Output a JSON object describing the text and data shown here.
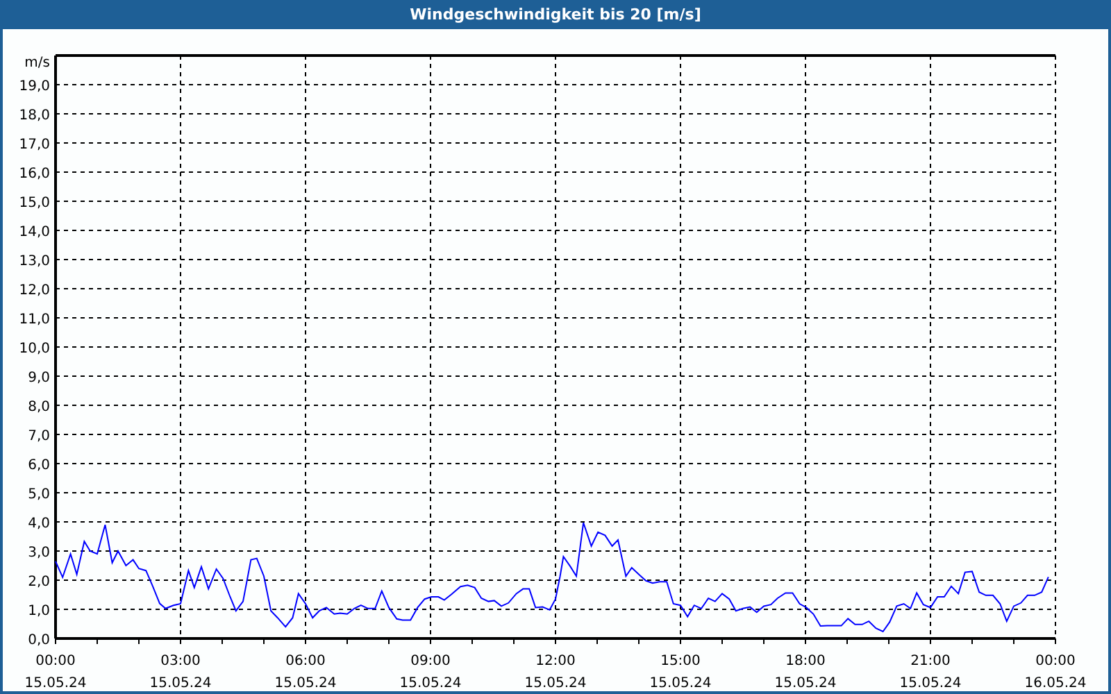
{
  "window": {
    "title": "Windgeschwindigkeit bis 20 [m/s]"
  },
  "chart": {
    "chart_data": {
      "type": "line",
      "grid": true,
      "ylabel": "m/s",
      "xlim": [
        0,
        24
      ],
      "ylim": [
        0,
        20
      ],
      "x": [
        0,
        0.17,
        0.36,
        0.51,
        0.69,
        0.83,
        1.0,
        1.19,
        1.36,
        1.5,
        1.69,
        1.86,
        2.0,
        2.17,
        2.33,
        2.5,
        2.64,
        2.83,
        3.0,
        3.19,
        3.33,
        3.5,
        3.67,
        3.86,
        4.02,
        4.19,
        4.33,
        4.5,
        4.69,
        4.83,
        5.0,
        5.17,
        5.33,
        5.52,
        5.69,
        5.83,
        6.0,
        6.17,
        6.33,
        6.5,
        6.69,
        6.83,
        7.0,
        7.17,
        7.33,
        7.5,
        7.67,
        7.83,
        8.0,
        8.19,
        8.33,
        8.52,
        8.69,
        8.86,
        9.02,
        9.19,
        9.33,
        9.5,
        9.72,
        9.89,
        10.06,
        10.22,
        10.39,
        10.53,
        10.7,
        10.87,
        11.06,
        11.22,
        11.37,
        11.52,
        11.69,
        11.86,
        12.0,
        12.11,
        12.19,
        12.36,
        12.5,
        12.67,
        12.86,
        13.02,
        13.19,
        13.36,
        13.5,
        13.69,
        13.83,
        14.02,
        14.17,
        14.33,
        14.5,
        14.67,
        14.83,
        15.0,
        15.17,
        15.33,
        15.5,
        15.67,
        15.83,
        16.0,
        16.17,
        16.33,
        16.5,
        16.67,
        16.83,
        17.0,
        17.17,
        17.33,
        17.52,
        17.69,
        17.86,
        18.02,
        18.19,
        18.36,
        18.52,
        18.69,
        18.86,
        19.02,
        19.19,
        19.36,
        19.52,
        19.69,
        19.86,
        20.02,
        20.19,
        20.36,
        20.52,
        20.67,
        20.83,
        21.0,
        21.17,
        21.33,
        21.5,
        21.67,
        21.83,
        22.0,
        22.17,
        22.33,
        22.5,
        22.67,
        22.83,
        23.0,
        23.17,
        23.33,
        23.5,
        23.67,
        23.83
      ],
      "series": [
        {
          "color": "#0000ff",
          "values": [
            2.65,
            2.1,
            2.9,
            2.2,
            3.33,
            3.0,
            2.9,
            3.9,
            2.6,
            3.0,
            2.5,
            2.7,
            2.4,
            2.33,
            1.8,
            1.2,
            1.03,
            1.14,
            1.19,
            2.33,
            1.75,
            2.46,
            1.7,
            2.38,
            2.06,
            1.43,
            0.95,
            1.27,
            2.7,
            2.75,
            2.14,
            0.95,
            0.71,
            0.4,
            0.71,
            1.54,
            1.19,
            0.71,
            0.95,
            1.06,
            0.84,
            0.87,
            0.84,
            1.03,
            1.14,
            1.03,
            1.03,
            1.63,
            1.06,
            0.67,
            0.63,
            0.63,
            1.06,
            1.35,
            1.43,
            1.43,
            1.32,
            1.51,
            1.78,
            1.83,
            1.75,
            1.38,
            1.27,
            1.3,
            1.11,
            1.22,
            1.54,
            1.7,
            1.7,
            1.06,
            1.08,
            0.98,
            1.35,
            2.14,
            2.81,
            2.46,
            2.14,
            3.97,
            3.17,
            3.65,
            3.54,
            3.17,
            3.38,
            2.14,
            2.43,
            2.17,
            1.98,
            1.9,
            1.95,
            1.95,
            1.19,
            1.14,
            0.75,
            1.14,
            1.03,
            1.38,
            1.27,
            1.54,
            1.35,
            0.95,
            1.03,
            1.08,
            0.9,
            1.11,
            1.16,
            1.38,
            1.56,
            1.56,
            1.19,
            1.06,
            0.84,
            0.43,
            0.44,
            0.44,
            0.44,
            0.68,
            0.48,
            0.48,
            0.59,
            0.35,
            0.24,
            0.56,
            1.11,
            1.19,
            1.03,
            1.56,
            1.16,
            1.06,
            1.43,
            1.43,
            1.79,
            1.54,
            2.27,
            2.3,
            1.59,
            1.48,
            1.48,
            1.19,
            0.59,
            1.11,
            1.22,
            1.48,
            1.48,
            1.59,
            2.11
          ]
        }
      ],
      "xticks": [
        {
          "value": 0,
          "label": "00:00"
        },
        {
          "value": 3,
          "label": "03:00"
        },
        {
          "value": 6,
          "label": "06:00"
        },
        {
          "value": 9,
          "label": "09:00"
        },
        {
          "value": 12,
          "label": "12:00"
        },
        {
          "value": 15,
          "label": "15:00"
        },
        {
          "value": 18,
          "label": "18:00"
        },
        {
          "value": 21,
          "label": "21:00"
        },
        {
          "value": 24,
          "label": "00:00"
        }
      ],
      "yticks": [
        {
          "value": 0,
          "label": "0,0"
        },
        {
          "value": 1,
          "label": "1,0"
        },
        {
          "value": 2,
          "label": "2,0"
        },
        {
          "value": 3,
          "label": "3,0"
        },
        {
          "value": 4,
          "label": "4,0"
        },
        {
          "value": 5,
          "label": "5,0"
        },
        {
          "value": 6,
          "label": "6,0"
        },
        {
          "value": 7,
          "label": "7,0"
        },
        {
          "value": 8,
          "label": "8,0"
        },
        {
          "value": 9,
          "label": "9,0"
        },
        {
          "value": 10,
          "label": "10,0"
        },
        {
          "value": 11,
          "label": "11,0"
        },
        {
          "value": 12,
          "label": "12,0"
        },
        {
          "value": 13,
          "label": "13,0"
        },
        {
          "value": 14,
          "label": "14,0"
        },
        {
          "value": 15,
          "label": "15,0"
        },
        {
          "value": 16,
          "label": "16,0"
        },
        {
          "value": 17,
          "label": "17,0"
        },
        {
          "value": 18,
          "label": "18,0"
        },
        {
          "value": 19,
          "label": "19,0"
        }
      ]
    },
    "x_tick_dates": [
      "15.05.24",
      "15.05.24",
      "15.05.24",
      "15.05.24",
      "15.05.24",
      "15.05.24",
      "15.05.24",
      "15.05.24",
      "16.05.24"
    ]
  }
}
